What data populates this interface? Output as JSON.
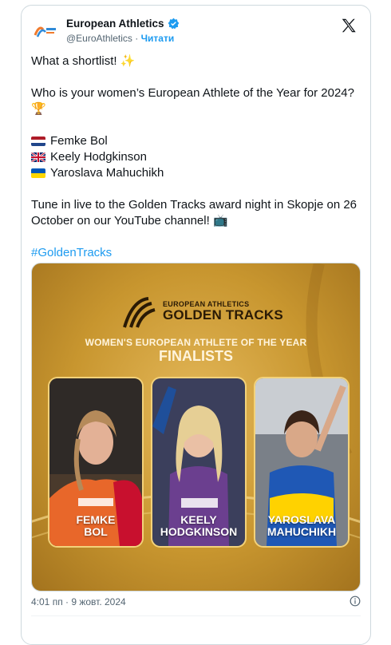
{
  "account": {
    "name": "European Athletics",
    "handle": "@EuroAthletics",
    "separator": "·",
    "follow_label": "Читати"
  },
  "tweet": {
    "line1": "What a shortlist! ✨",
    "line2": "Who is your women’s European Athlete of the Year for 2024? 🏆",
    "finalists": [
      {
        "flag": "NL",
        "name": "Femke Bol"
      },
      {
        "flag": "GB",
        "name": "Keely Hodgkinson"
      },
      {
        "flag": "UA",
        "name": "Yaroslava Mahuchikh"
      }
    ],
    "line3": "Tune in live to the Golden Tracks award night in Skopje on 26 October on our YouTube channel! 📺",
    "hashtag": "#GoldenTracks"
  },
  "media": {
    "brand_small": "EUROPEAN ATHLETICS",
    "brand_big": "GOLDEN TRACKS",
    "title_line1": "WOMEN'S EUROPEAN ATHLETE OF THE YEAR",
    "title_line2": "FINALISTS",
    "panels": [
      {
        "first": "FEMKE",
        "last": "BOL"
      },
      {
        "first": "KEELY",
        "last": "HODGKINSON"
      },
      {
        "first": "YAROSLAVA",
        "last": "MAHUCHIKH"
      }
    ]
  },
  "footer": {
    "timestamp": "4:01 пп · 9 жовт. 2024"
  }
}
